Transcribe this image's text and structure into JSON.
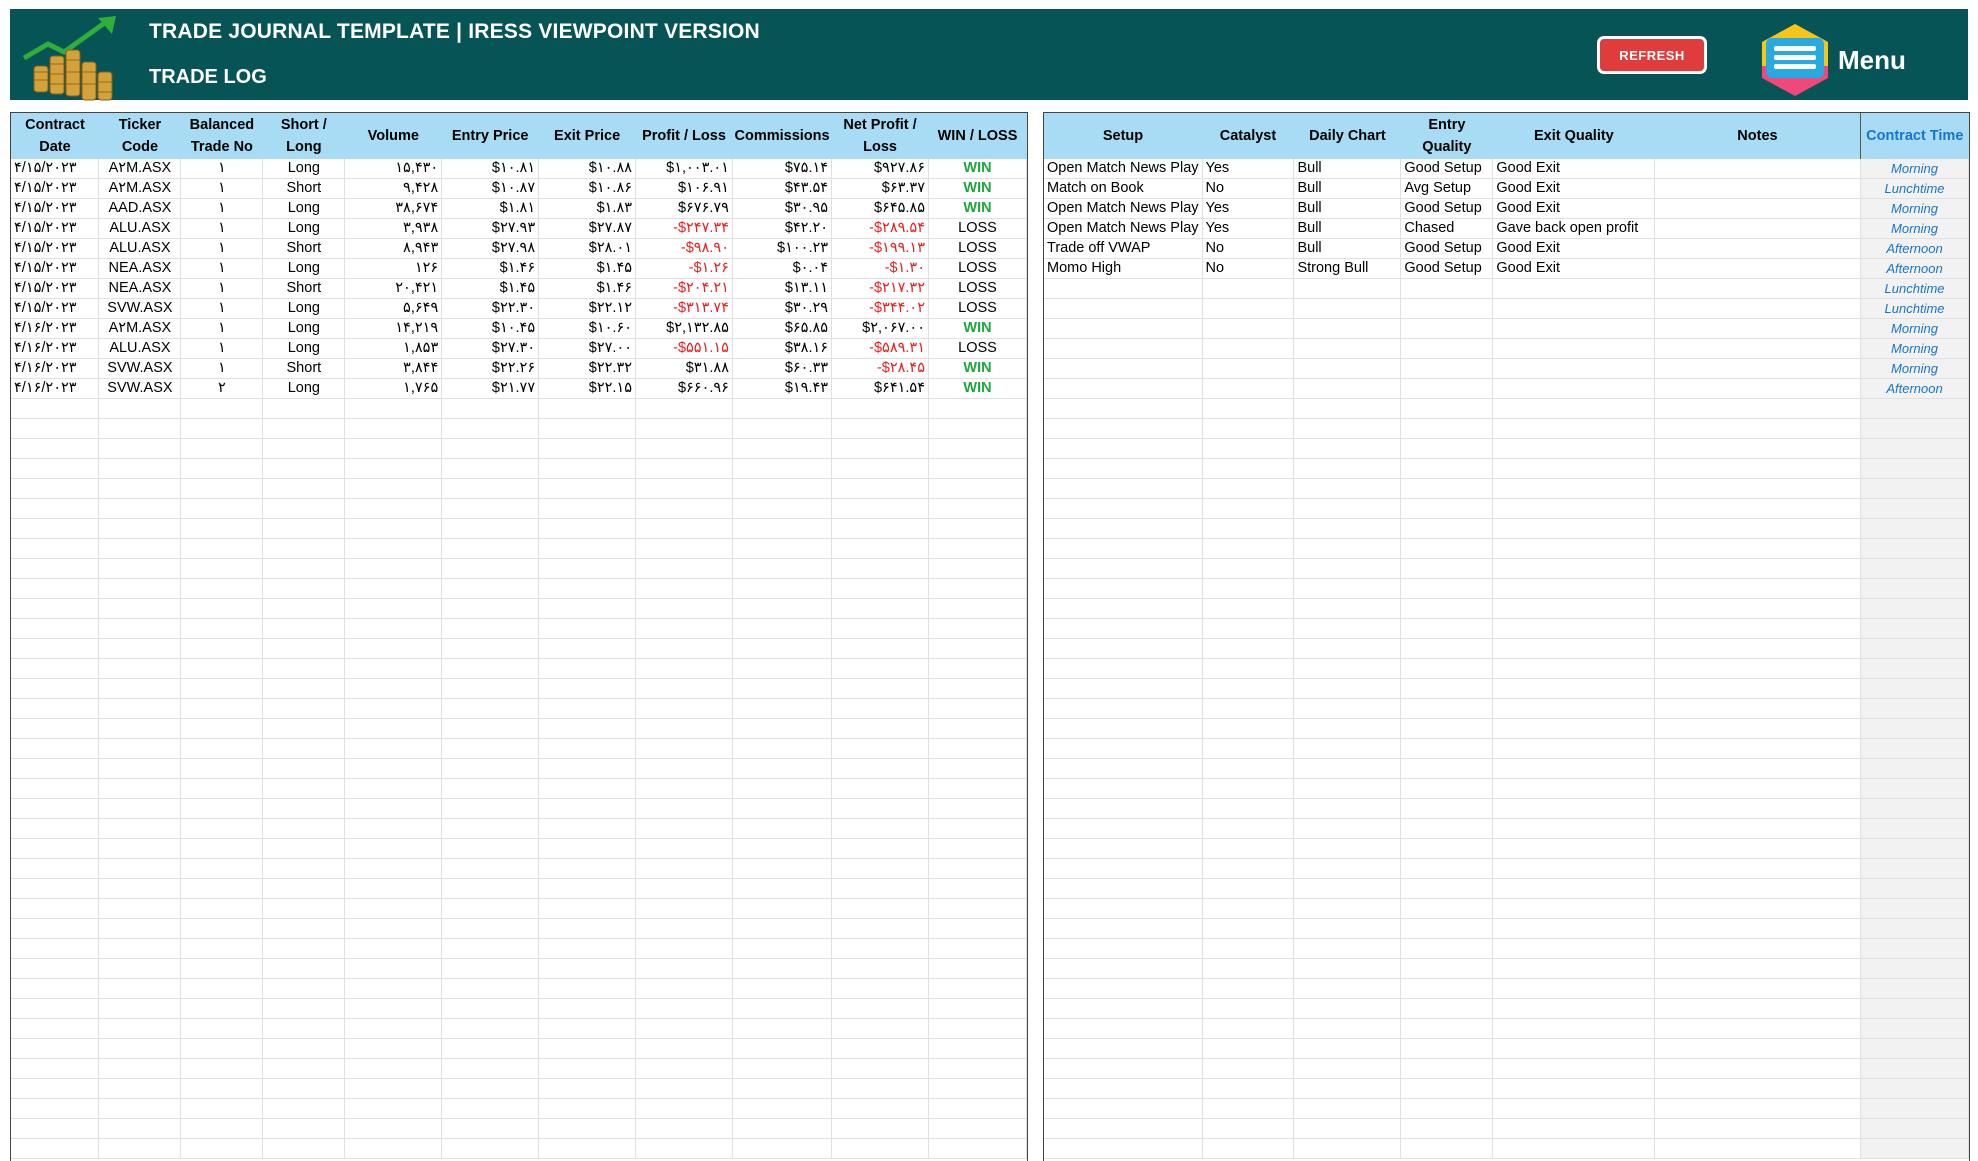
{
  "header": {
    "title": "TRADE JOURNAL TEMPLATE | IRESS VIEWPOINT VERSION",
    "subtitle": "TRADE LOG",
    "refresh_label": "REFRESH",
    "menu_label": "Menu"
  },
  "colors": {
    "header_bg": "#075456",
    "table_header_bg": "#a7dcf4",
    "win": "#1ea63c",
    "negative": "#e8201d",
    "contract_time": "#1874c9",
    "refresh_button": "#e03c3c"
  },
  "icons": {
    "logo": "coins-growth-logo-icon",
    "menu": "hamburger-menu-icon"
  },
  "trade_log": {
    "columns": [
      "Contract Date",
      "Ticker Code",
      "Balanced Trade No",
      "Short / Long",
      "Volume",
      "Entry Price",
      "Exit Price",
      "Profit / Loss",
      "Commissions",
      "Net Profit / Loss",
      "WIN / LOSS"
    ],
    "rows": [
      [
        "۴/۱۵/۲۰۲۳",
        "A۲M.ASX",
        "۱",
        "Long",
        "۱۵,۴۳۰",
        "$۱۰.۸۱",
        "$۱۰.۸۸",
        "$۱,۰۰۳.۰۱",
        "$۷۵.۱۴",
        "$۹۲۷.۸۶",
        "WIN"
      ],
      [
        "۴/۱۵/۲۰۲۳",
        "A۲M.ASX",
        "۱",
        "Short",
        "۹,۴۲۸",
        "$۱۰.۸۷",
        "$۱۰.۸۶",
        "$۱۰۶.۹۱",
        "$۴۳.۵۴",
        "$۶۳.۳۷",
        "WIN"
      ],
      [
        "۴/۱۵/۲۰۲۳",
        "AAD.ASX",
        "۱",
        "Long",
        "۳۸,۶۷۴",
        "$۱.۸۱",
        "$۱.۸۳",
        "$۶۷۶.۷۹",
        "$۳۰.۹۵",
        "$۶۴۵.۸۵",
        "WIN"
      ],
      [
        "۴/۱۵/۲۰۲۳",
        "ALU.ASX",
        "۱",
        "Long",
        "۳,۹۳۸",
        "$۲۷.۹۳",
        "$۲۷.۸۷",
        "-$۲۴۷.۳۴",
        "$۴۲.۲۰",
        "-$۲۸۹.۵۴",
        "LOSS"
      ],
      [
        "۴/۱۵/۲۰۲۳",
        "ALU.ASX",
        "۱",
        "Short",
        "۸,۹۴۳",
        "$۲۷.۹۸",
        "$۲۸.۰۱",
        "-$۹۸.۹۰",
        "$۱۰۰.۲۳",
        "-$۱۹۹.۱۳",
        "LOSS"
      ],
      [
        "۴/۱۵/۲۰۲۳",
        "NEA.ASX",
        "۱",
        "Long",
        "۱۲۶",
        "$۱.۴۶",
        "$۱.۴۵",
        "-$۱.۲۶",
        "$۰.۰۴",
        "-$۱.۳۰",
        "LOSS"
      ],
      [
        "۴/۱۵/۲۰۲۳",
        "NEA.ASX",
        "۱",
        "Short",
        "۲۰,۴۲۱",
        "$۱.۴۵",
        "$۱.۴۶",
        "-$۲۰۴.۲۱",
        "$۱۳.۱۱",
        "-$۲۱۷.۳۲",
        "LOSS"
      ],
      [
        "۴/۱۵/۲۰۲۳",
        "SVW.ASX",
        "۱",
        "Long",
        "۵,۶۴۹",
        "$۲۲.۳۰",
        "$۲۲.۱۲",
        "-$۳۱۳.۷۴",
        "$۳۰.۲۹",
        "-$۳۴۴.۰۲",
        "LOSS"
      ],
      [
        "۴/۱۶/۲۰۲۳",
        "A۲M.ASX",
        "۱",
        "Long",
        "۱۴,۲۱۹",
        "$۱۰.۴۵",
        "$۱۰.۶۰",
        "$۲,۱۳۲.۸۵",
        "$۶۵.۸۵",
        "$۲,۰۶۷.۰۰",
        "WIN"
      ],
      [
        "۴/۱۶/۲۰۲۳",
        "ALU.ASX",
        "۱",
        "Long",
        "۱,۸۵۳",
        "$۲۷.۳۰",
        "$۲۷.۰۰",
        "-$۵۵۱.۱۵",
        "$۳۸.۱۶",
        "-$۵۸۹.۳۱",
        "LOSS"
      ],
      [
        "۴/۱۶/۲۰۲۳",
        "SVW.ASX",
        "۱",
        "Short",
        "۳,۸۴۴",
        "$۲۲.۲۶",
        "$۲۲.۳۲",
        "$۳۱.۸۸",
        "$۶۰.۳۳",
        "-$۲۸.۴۵",
        "WIN"
      ],
      [
        "۴/۱۶/۲۰۲۳",
        "SVW.ASX",
        "۲",
        "Long",
        "۱,۷۶۵",
        "$۲۱.۷۷",
        "$۲۲.۱۵",
        "$۶۶۰.۹۶",
        "$۱۹.۴۳",
        "$۶۴۱.۵۴",
        "WIN"
      ]
    ]
  },
  "notes_log": {
    "columns": [
      "Setup",
      "Catalyst",
      "Daily Chart",
      "Entry Quality",
      "Exit Quality",
      "Notes",
      "Contract Time"
    ],
    "rows": [
      [
        "Open Match News Play",
        "Yes",
        "Bull",
        "Good Setup",
        "Good Exit",
        "",
        "Morning"
      ],
      [
        "Match on Book",
        "No",
        "Bull",
        "Avg Setup",
        "Good Exit",
        "",
        "Lunchtime"
      ],
      [
        "Open Match News Play",
        "Yes",
        "Bull",
        "Good Setup",
        "Good Exit",
        "",
        "Morning"
      ],
      [
        "Open Match News Play",
        "Yes",
        "Bull",
        "Chased",
        "Gave back open profit",
        "",
        "Morning"
      ],
      [
        "Trade off VWAP",
        "No",
        "Bull",
        "Good Setup",
        "Good Exit",
        "",
        "Afternoon"
      ],
      [
        "Momo High",
        "No",
        "Strong Bull",
        "Good Setup",
        "Good Exit",
        "",
        "Afternoon"
      ],
      [
        "",
        "",
        "",
        "",
        "",
        "",
        "Lunchtime"
      ],
      [
        "",
        "",
        "",
        "",
        "",
        "",
        "Lunchtime"
      ],
      [
        "",
        "",
        "",
        "",
        "",
        "",
        "Morning"
      ],
      [
        "",
        "",
        "",
        "",
        "",
        "",
        "Morning"
      ],
      [
        "",
        "",
        "",
        "",
        "",
        "",
        "Morning"
      ],
      [
        "",
        "",
        "",
        "",
        "",
        "",
        "Afternoon"
      ]
    ]
  }
}
